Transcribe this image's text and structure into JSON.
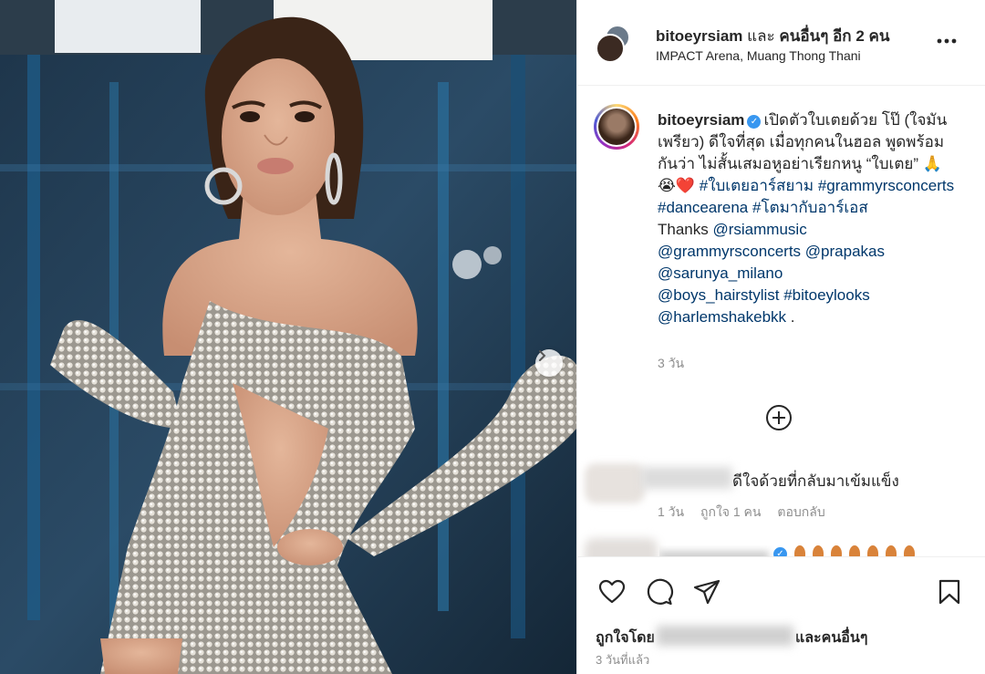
{
  "post": {
    "header": {
      "username": "bitoeyrsiam",
      "joiner": "และ",
      "others": "คนอื่นๆ อีก 2 คน",
      "location": "IMPACT Arena, Muang Thong Thani",
      "more_icon": "more-horizontal-icon"
    },
    "caption": {
      "username": "bitoeyrsiam",
      "text_main": "เปิดตัวใบเตยด้วย โป๊ (ใจมันเพรียว) ดีใจที่สุด เมื่อทุกคนในฮอล พูดพร้อมกันว่า ไม่สั้นเสมอหูอย่าเรียกหนู “ใบเตย”",
      "emoji": "🙏😭❤️",
      "tag1": "#ใบเตยอาร์สยาม",
      "tag2": "#grammyrsconcerts",
      "tag3": "#dancearena",
      "tag4": "#โตมากับอาร์เอส",
      "thanks": "Thanks",
      "mention1": "@rsiammusic",
      "mention2": "@grammyrsconcerts",
      "mention3": "@prapakas",
      "mention4": "@sarunya_milano",
      "mention5": "@boys_hairstylist",
      "tag5": "#bitoeylooks",
      "mention6": "@harlemshakebkk",
      "end": ".",
      "time": "3 วัน"
    },
    "comment": {
      "text": "ดีใจด้วยที่กลับมาเข้มแข็ง",
      "time": "1 วัน",
      "likes": "ถูกใจ 1 คน",
      "reply": "ตอบกลับ"
    },
    "likes": {
      "prefix": "ถูกใจโดย",
      "suffix_joiner": "และ",
      "suffix_others": "คนอื่นๆ"
    },
    "time": "3 วันที่แล้ว"
  },
  "colors": {
    "link": "#00376b",
    "verified": "#3897f0",
    "muted": "#8e8e8e"
  }
}
